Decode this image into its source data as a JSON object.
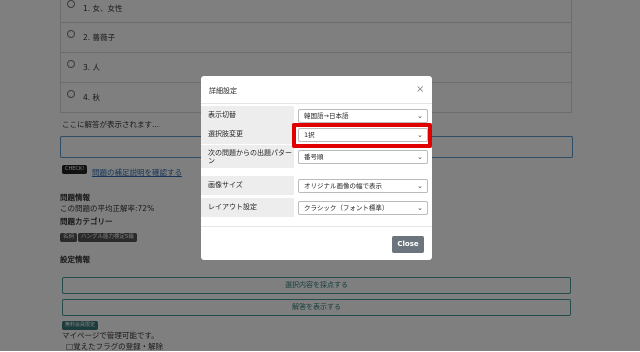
{
  "question_options": [
    "1. 女、女性",
    "2. 薔薇子",
    "3. 人",
    "4. 秋"
  ],
  "answer_placeholder": "ここに解答が表示されます...",
  "check_badge": "CHECK!",
  "supplement_link": "問題の補足説明を確認する",
  "problem_info": {
    "heading": "問題情報",
    "accuracy": "この問題の平均正解率:72%"
  },
  "category": {
    "heading": "問題カテゴリー",
    "tags": [
      "名詞",
      "ハングル能力検定5級"
    ]
  },
  "settings_heading": "設定情報",
  "buttons": {
    "grade": "選択内容を採点する",
    "show_answer": "解答を表示する"
  },
  "member_badge": "無料会員限定",
  "mypage_text": "マイページで管理可能です。",
  "flag_text": "□覚えたフラグの登録・解除",
  "modal": {
    "title": "詳細設定",
    "close_x": "×",
    "close_button": "Close",
    "rows": [
      {
        "label": "表示切替",
        "value": "韓国語→日本語"
      },
      {
        "label": "選択肢変更",
        "value": "1択"
      },
      {
        "label": "次の問題からの出題パターン",
        "value": "番号順"
      },
      {
        "label": "画像サイズ",
        "value": "オリジナル画像の幅で表示"
      },
      {
        "label": "レイアウト設定",
        "value": "クラシック（フォント標準）"
      }
    ]
  },
  "colors": {
    "highlight": "#e00000",
    "close_button": "#6c757d",
    "accent": "#2b7a7a"
  }
}
